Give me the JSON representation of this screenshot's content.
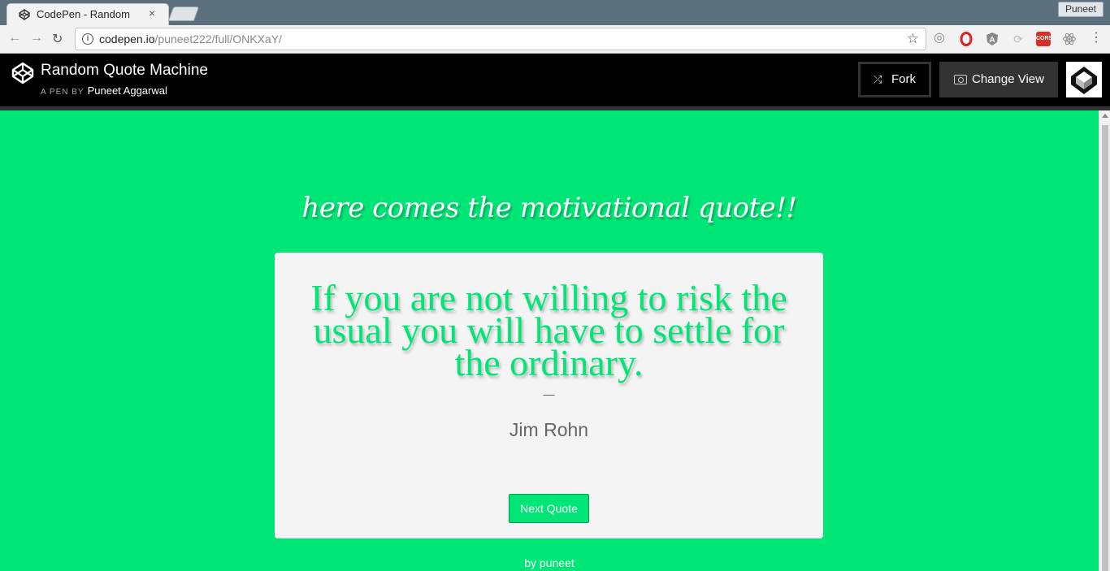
{
  "browser": {
    "tab_title": "CodePen - Random",
    "tab_close": "×",
    "profile_name": "Puneet",
    "url_domain": "codepen.io",
    "url_path": "/puneet222/full/ONKXaY/",
    "info_glyph": "i",
    "star_glyph": "☆",
    "extensions": [
      "opera-icon",
      "angular-icon",
      "refresh-icon",
      "cors-icon",
      "react-icon",
      "menu-icon"
    ],
    "cors_label": "CORS"
  },
  "codepen": {
    "pen_title": "Random Quote Machine",
    "by_prefix": "A PEN BY",
    "author": "Puneet Aggarwal",
    "fork_label": "Fork",
    "change_view_label": "Change View"
  },
  "page": {
    "heading": "here comes the motivational quote!!",
    "quote": "If you are not willing to risk the usual you will have to settle for the ordinary.",
    "dash": "—",
    "author": "Jim Rohn",
    "button_label": "Next Quote",
    "footer": "by puneet"
  },
  "colors": {
    "accent": "#00e676",
    "header_bg": "#000000",
    "card_bg": "#f4f4f4"
  }
}
